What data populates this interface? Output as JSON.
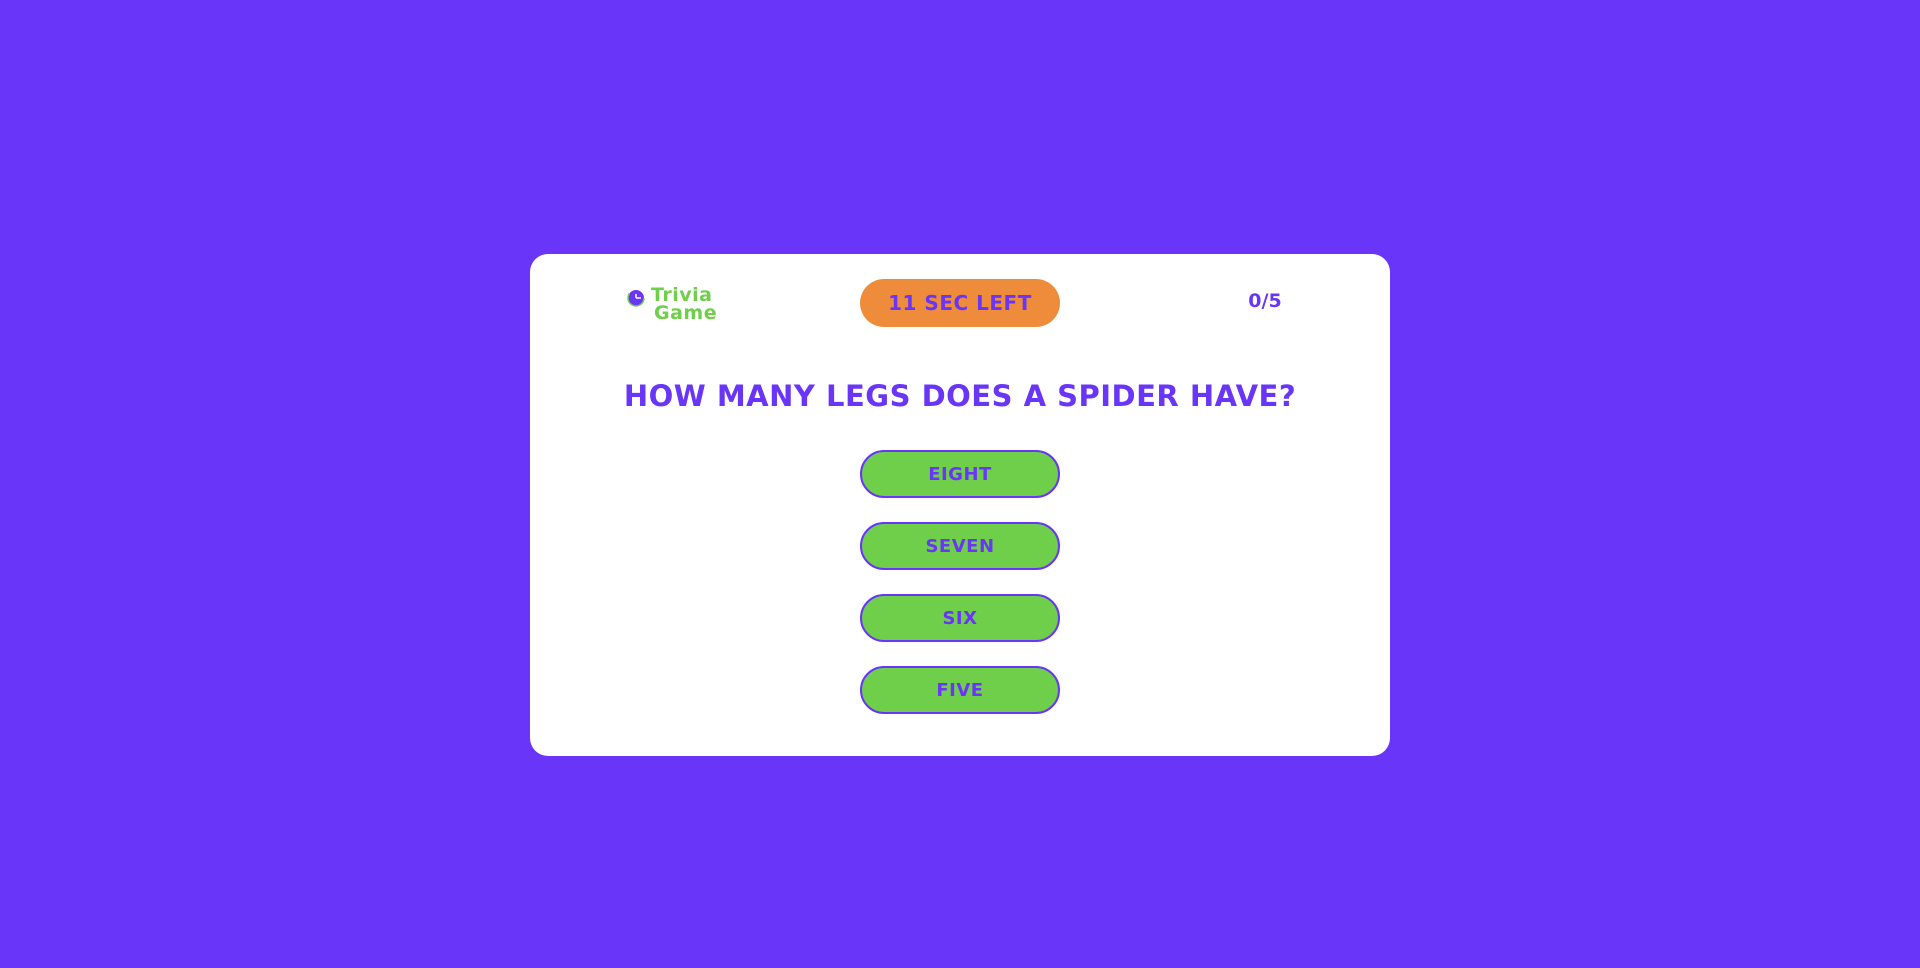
{
  "logo": {
    "line1": "Trivia",
    "line2": "Game",
    "icon": "clock-icon",
    "color": "#6fcf4a"
  },
  "timer": {
    "label": "11 sec left",
    "color": "#ee8c3b"
  },
  "score": {
    "text": "0/5"
  },
  "question": {
    "text": "How many legs does a spider have?"
  },
  "answers": [
    {
      "label": "Eight"
    },
    {
      "label": "Seven"
    },
    {
      "label": "Six"
    },
    {
      "label": "Five"
    }
  ],
  "colors": {
    "background": "#6935f8",
    "card": "#ffffff",
    "answer_fill": "#6fcf4a",
    "text_accent": "#6935f8"
  }
}
